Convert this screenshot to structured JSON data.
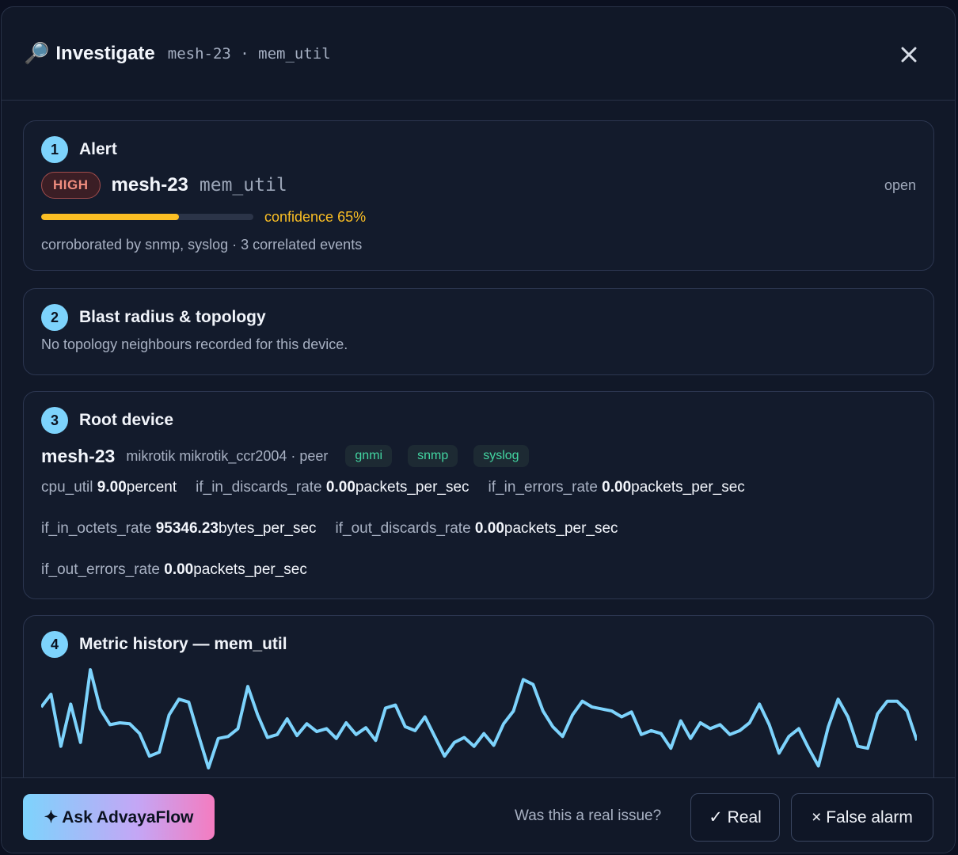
{
  "header": {
    "icon": "magnifier-icon",
    "title": "Investigate",
    "subtitle": "mesh-23 · mem_util",
    "close_icon": "close-icon"
  },
  "alert": {
    "number": "1",
    "title": "Alert",
    "severity": "HIGH",
    "device": "mesh-23",
    "metric": "mem_util",
    "state": "open",
    "confidence": 0.65,
    "confidence_label": "confidence 65%",
    "corroboration": "corroborated by snmp, syslog · 3 correlated events"
  },
  "blast": {
    "number": "2",
    "title": "Blast radius & topology",
    "message": "No topology neighbours recorded for this device."
  },
  "root": {
    "number": "3",
    "title": "Root device",
    "device": "mesh-23",
    "description": "mikrotik mikrotik_ccr2004 · peer",
    "tags": [
      "gnmi",
      "snmp",
      "syslog"
    ],
    "metrics": [
      {
        "name": "cpu_util",
        "value": "9.00",
        "unit": "percent"
      },
      {
        "name": "if_in_discards_rate",
        "value": "0.00",
        "unit": "packets_per_sec"
      },
      {
        "name": "if_in_errors_rate",
        "value": "0.00",
        "unit": "packets_per_sec"
      },
      {
        "name": "if_in_octets_rate",
        "value": "95346.23",
        "unit": "bytes_per_sec"
      },
      {
        "name": "if_out_discards_rate",
        "value": "0.00",
        "unit": "packets_per_sec"
      },
      {
        "name": "if_out_errors_rate",
        "value": "0.00",
        "unit": "packets_per_sec"
      }
    ]
  },
  "history": {
    "number": "4",
    "title": "Metric history — mem_util"
  },
  "chart_data": {
    "type": "line",
    "title": "Metric history — mem_util",
    "color": "#7dd3fc",
    "series": [
      {
        "values": [
          62,
          75,
          22,
          65,
          26,
          100,
          60,
          44,
          46,
          45,
          35,
          12,
          16,
          54,
          70,
          67,
          33,
          0,
          30,
          32,
          40,
          83,
          54,
          31,
          34,
          50,
          33,
          45,
          37,
          40,
          30,
          46,
          34,
          41,
          28,
          61,
          64,
          42,
          38,
          52,
          32,
          12,
          26,
          31,
          22,
          35,
          23,
          45,
          58,
          90,
          85,
          58,
          42,
          32,
          54,
          68,
          62,
          60,
          58,
          52,
          57,
          34,
          38,
          35,
          20,
          48,
          30,
          46,
          40,
          44,
          34,
          38,
          46,
          65,
          44,
          15,
          32,
          40,
          20,
          2,
          42,
          70,
          52,
          22,
          20,
          55,
          68,
          68,
          58,
          28,
          7,
          47,
          66,
          40,
          60,
          32,
          48,
          32,
          53,
          38,
          46,
          35,
          50,
          40,
          35,
          24,
          52,
          40,
          12,
          38,
          72,
          56,
          46,
          43,
          34,
          46,
          47,
          38,
          51,
          42,
          48,
          40,
          39,
          38,
          40,
          50,
          40,
          40,
          58,
          64,
          44,
          38,
          38,
          43,
          31,
          58,
          56,
          55,
          55,
          48,
          40,
          36,
          44,
          60,
          55,
          42,
          55,
          54,
          45,
          38,
          44,
          55,
          58,
          52,
          48,
          32,
          42,
          45,
          43,
          40,
          38,
          35,
          40,
          46,
          57,
          42,
          64,
          44,
          52,
          45,
          34,
          28,
          38,
          40,
          40,
          36,
          30,
          40,
          52,
          58,
          55,
          48,
          52,
          55,
          50,
          40,
          38,
          44,
          38,
          60,
          42,
          46,
          44,
          36,
          37,
          40,
          44,
          42,
          55,
          66,
          58,
          44,
          38,
          36,
          56,
          70,
          60,
          46,
          42,
          45,
          54,
          47,
          40,
          38,
          45,
          46,
          48,
          60,
          56,
          63,
          64,
          58,
          55,
          46,
          43,
          34,
          42,
          46,
          48,
          44,
          40,
          45,
          44,
          56,
          40,
          34,
          47,
          64,
          56,
          55,
          37,
          50,
          53,
          48,
          44,
          40,
          50,
          46,
          45,
          39,
          50,
          43,
          46,
          47,
          42,
          42,
          44,
          46,
          40,
          38,
          48,
          44,
          52,
          46,
          42,
          40,
          46,
          42,
          50,
          46,
          42,
          38,
          40,
          44,
          46,
          48,
          42,
          44,
          58,
          60,
          55,
          45,
          42,
          55,
          50,
          46,
          42,
          40,
          42,
          50,
          62,
          58,
          50,
          46,
          44,
          43,
          50,
          48,
          46,
          42,
          40,
          54,
          55,
          40,
          44,
          45,
          46,
          44,
          42,
          43,
          46,
          44,
          42,
          48,
          64,
          58,
          52,
          42,
          40,
          44,
          46,
          44,
          54,
          50,
          48,
          42,
          40,
          44,
          54,
          46,
          46,
          48,
          42,
          44,
          46,
          47,
          44,
          52,
          58,
          62,
          56,
          46,
          44,
          46,
          52,
          44,
          46,
          56,
          50,
          54,
          45,
          48,
          46,
          38,
          46,
          50,
          46,
          44,
          43,
          42,
          40,
          44,
          46,
          44,
          42,
          55,
          60,
          56,
          46,
          44,
          40,
          42,
          46,
          44,
          40,
          42,
          44,
          46,
          52,
          58,
          62,
          66,
          56,
          48,
          46,
          44,
          42,
          50,
          46,
          44,
          40,
          42,
          46,
          48,
          50,
          46,
          44,
          40,
          48,
          56,
          50,
          44,
          42,
          43,
          44,
          46,
          48,
          46,
          52,
          56,
          60,
          50,
          46,
          44,
          42,
          38,
          44,
          42,
          50,
          56,
          58,
          52,
          48,
          46,
          44,
          40,
          34,
          30,
          22,
          10,
          0,
          5,
          35
        ]
      }
    ]
  },
  "footer": {
    "ask_label": "✦ Ask AdvayaFlow",
    "question": "Was this a real issue?",
    "real_label": "✓ Real",
    "false_label": "× False alarm"
  }
}
